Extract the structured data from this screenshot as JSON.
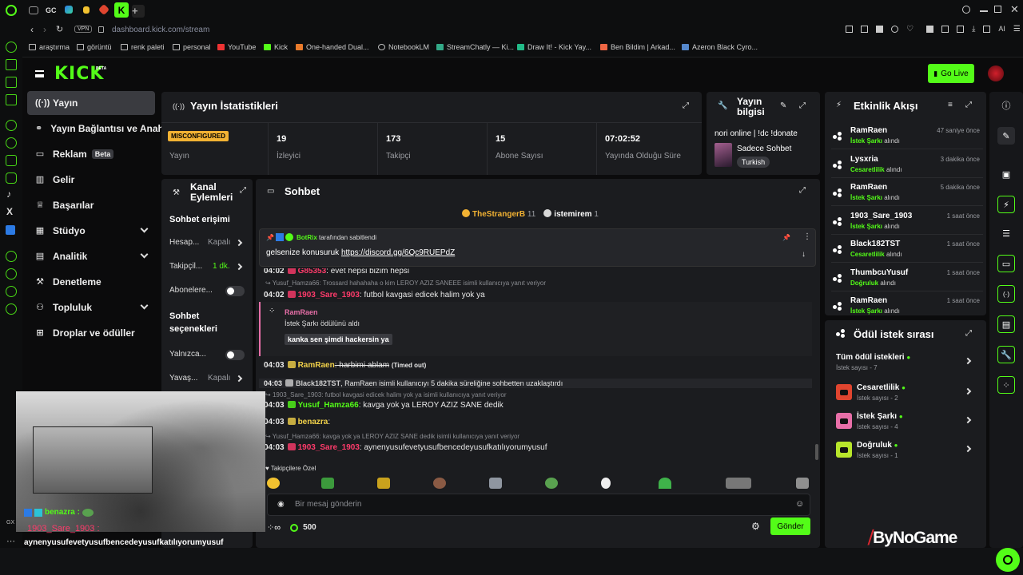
{
  "browser": {
    "tabs": [
      "GX"
    ],
    "url": "dashboard.kick.com/stream",
    "vpn_label": "VPN",
    "ai_label": "AI",
    "bookmarks": [
      "araştırma",
      "görüntü",
      "renk paleti",
      "personal",
      "YouTube",
      "Kick",
      "One-handed Dual...",
      "NotebookLM",
      "StreamChatly — Ki...",
      "Draw It! - Kick Yay...",
      "Ben Bildim | Arkad...",
      "Azeron Black Cyro..."
    ]
  },
  "header": {
    "logo": "KICK",
    "logo_badge": "BETA",
    "go_live_label": "Go Live"
  },
  "sidebar": {
    "items": [
      {
        "label": "Yayın",
        "icon": "broadcast-icon",
        "active": true
      },
      {
        "label": "Yayın Bağlantısı ve Anahtarı",
        "icon": "link-icon"
      },
      {
        "label": "Reklam",
        "icon": "ad-icon",
        "badge": "Beta"
      },
      {
        "label": "Gelir",
        "icon": "chart-icon"
      },
      {
        "label": "Başarılar",
        "icon": "trophy-icon"
      },
      {
        "label": "Stüdyo",
        "icon": "studio-icon",
        "expand": true
      },
      {
        "label": "Analitik",
        "icon": "analytics-icon",
        "expand": true
      },
      {
        "label": "Denetleme",
        "icon": "hammer-icon"
      },
      {
        "label": "Topluluk",
        "icon": "users-icon",
        "expand": true
      },
      {
        "label": "Droplar ve ödüller",
        "icon": "gift-icon"
      }
    ]
  },
  "stats": {
    "title": "Yayın İstatistikleri",
    "items": [
      {
        "value": "MISCONFIGURED",
        "label": "Yayın",
        "badge": true
      },
      {
        "value": "19",
        "label": "İzleyici"
      },
      {
        "value": "173",
        "label": "Takipçi"
      },
      {
        "value": "15",
        "label": "Abone Sayısı"
      },
      {
        "value": "07:02:52",
        "label": "Yayında Olduğu Süre"
      }
    ]
  },
  "stream_info": {
    "title": "Yayın bilgisi",
    "stream_title": "nori online | !dc !donate",
    "category": "Sadece Sohbet",
    "language": "Turkish"
  },
  "channel_actions": {
    "title": "Kanal Eylemleri",
    "access_title": "Sohbet erişimi",
    "rows": [
      {
        "label": "Hesap...",
        "value": "Kapalı",
        "type": "chevron"
      },
      {
        "label": "Takipçil...",
        "value": "1 dk.",
        "type": "chevron",
        "highlight": true
      },
      {
        "label": "Abonelere...",
        "type": "toggle"
      }
    ],
    "options_title": "Sohbet seçenekleri",
    "option_rows": [
      {
        "label": "Yalnızca...",
        "type": "toggle"
      },
      {
        "label": "Yavaş...",
        "value": "Kapalı",
        "type": "chevron"
      }
    ]
  },
  "chat": {
    "title": "Sohbet",
    "top_gifters": [
      {
        "name": "TheStrangerB",
        "count": "11"
      },
      {
        "name": "istemirem",
        "count": "1"
      }
    ],
    "pinned": {
      "by": "BotRix",
      "by_suffix": "tarafından sabitlendi",
      "text": "gelsenize konusuruk",
      "link": "https://discord.gg/6Qc9RUEPdZ"
    },
    "messages": [
      {
        "time": "04:02",
        "user": "G85353",
        "text": ": evet hepsi bizim hepsi"
      },
      {
        "reply": "Yusuf_Hamza66: Trossard hahahaha o kim LEROY AZIZ SANEEE isimli kullanıcıya yanıt veriyor"
      },
      {
        "time": "04:02",
        "user": "1903_Sare_1903",
        "text": ": futbol kavgasi edicek halim yok ya"
      },
      {
        "time": "04:03",
        "user": "RamRaen",
        "text": ": harbimi ablam",
        "suffix": "(Timed out)"
      },
      {
        "time": "04:03",
        "user": "Black182TST",
        "text": ", RamRaen isimli kullanıcıyı 5 dakika süreliğine sohbetten uzaklaştırdı"
      },
      {
        "reply": "1903_Sare_1903: futbol kavgasi edicek halim yok ya isimli kullanıcıya yanıt veriyor"
      },
      {
        "time": "04:03",
        "user": "Yusuf_Hamza66",
        "text": ": kavga yok ya LEROY AZIZ SANE dedik"
      },
      {
        "time": "04:03",
        "user": "benazra",
        "text": ":"
      },
      {
        "reply": "Yusuf_Hamza66: kavga yok ya LEROY AZIZ SANE dedik isimli kullanıcıya yanıt veriyor"
      },
      {
        "time": "04:03",
        "user": "1903_Sare_1903",
        "text": ": aynenyusufevetyusufbencedeyusufkatılıyorumyusuf"
      }
    ],
    "reward": {
      "user": "RamRaen",
      "line": "İstek Şarkı ödülünü aldı",
      "text": "kanka sen şimdi hackersin ya"
    },
    "followers_only_label": "Takipçilere Özel",
    "input_placeholder": "Bir mesaj gönderin",
    "points": "500",
    "send_label": "Gönder"
  },
  "activity": {
    "title": "Etkinlik Akışı",
    "events": [
      {
        "user": "RamRaen",
        "reward": "İstek Şarkı",
        "action": "alındı",
        "time": "47 saniye önce"
      },
      {
        "user": "Lysxria",
        "reward": "Cesaretlilik",
        "action": "alındı",
        "time": "3 dakika önce"
      },
      {
        "user": "RamRaen",
        "reward": "İstek Şarkı",
        "action": "alındı",
        "time": "5 dakika önce"
      },
      {
        "user": "1903_Sare_1903",
        "reward": "İstek Şarkı",
        "action": "alındı",
        "time": "1 saat önce"
      },
      {
        "user": "Black182TST",
        "reward": "Cesaretlilik",
        "action": "alındı",
        "time": "1 saat önce"
      },
      {
        "user": "ThumbcuYusuf",
        "reward": "Doğruluk",
        "action": "alındı",
        "time": "1 saat önce"
      },
      {
        "user": "RamRaen",
        "reward": "İstek Şarkı",
        "action": "alındı",
        "time": "1 saat önce"
      }
    ]
  },
  "rewards": {
    "title": "Ödül istek sırası",
    "items": [
      {
        "name": "Tüm ödül istekleri",
        "sub": "İstek sayısı - 7",
        "color": ""
      },
      {
        "name": "Cesaretlilik",
        "sub": "İstek sayısı - 2",
        "color": "#e0452f"
      },
      {
        "name": "İstek Şarkı",
        "sub": "İstek sayısı - 4",
        "color": "#e86fa8"
      },
      {
        "name": "Doğruluk",
        "sub": "İstek sayısı - 1",
        "color": "#b8e62b"
      }
    ]
  },
  "overlay": {
    "user1": "benazra :",
    "user2": "1903_Sare_1903 :",
    "text2": "aynenyusufevetyusufbencedeyusufkatılıyorumyusuf"
  },
  "watermark": "ByNoGame",
  "colors": {
    "accent": "#53fc18",
    "bg": "#0b0b0c",
    "panel": "#1b1c1f"
  }
}
